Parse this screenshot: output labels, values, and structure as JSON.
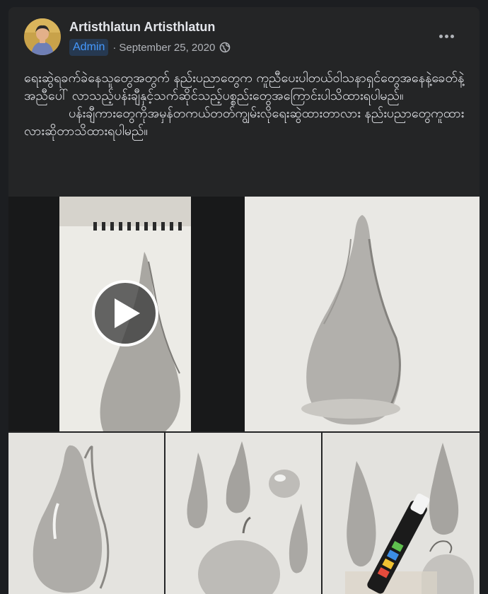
{
  "post": {
    "author": "Artisthlatun Artisthlatun",
    "badge": "Admin",
    "separator": "·",
    "date": "September 25, 2020",
    "privacy_icon": "globe-icon",
    "more_icon": "more-options-icon",
    "text": [
      "ရေးဆွဲရခက်ခဲနေသူတွေအတွက် နည်းပညာတွေက ကူညီပေးပါတယ်ဝါသနာရှင်တွေအနေနဲ့ခေတ်နဲ့အညီပေါ် လာသည့်ပန်းချီနှင့်သက်ဆိုင်သည့်ပစ္စည်းတွေအကြောင်းပါသိထားရပါမည်။",
      "           ပန်းချီကားတွေကိုအမှန်တကယ်တတ်ကျွမ်းလိုရေးဆွဲထားတာလား နည်းပညာတွေကူထားလားဆိုတာသိထားရပါမည်။"
    ]
  },
  "media": {
    "play_icon": "play-icon",
    "photos": [
      "video-sketch-drop",
      "drop-drawing-large",
      "drop-drawing-closeup",
      "drops-and-fruit",
      "drops-with-posca-marker"
    ]
  },
  "colors": {
    "card_bg": "#242526",
    "page_bg": "#1c1e21",
    "text": "#e4e6eb",
    "secondary_text": "#b0b3b8",
    "badge_bg": "#263951",
    "badge_text": "#4599ff"
  }
}
